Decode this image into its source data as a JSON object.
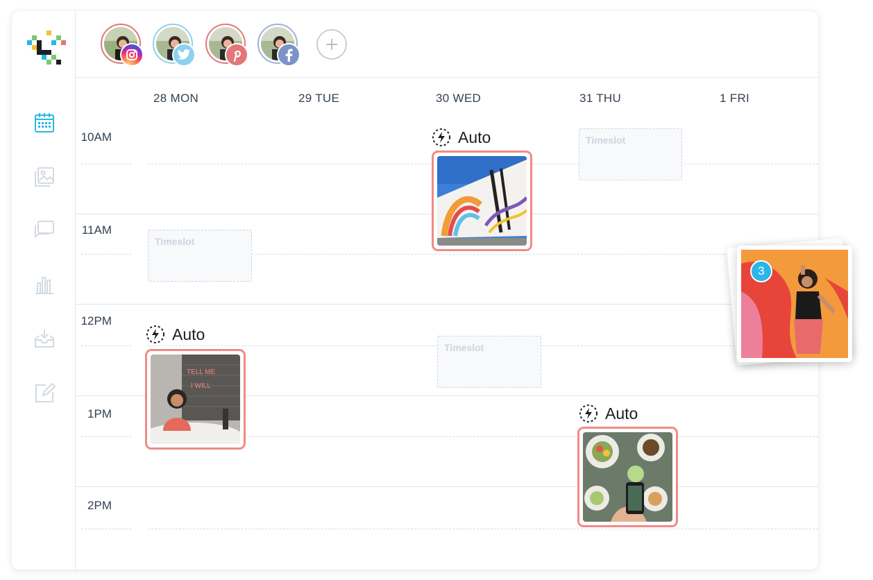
{
  "colors": {
    "accent": "#29b6e8",
    "post_border": "#f08a86",
    "instagram": "#d6249f",
    "twitter": "#55acee",
    "pinterest": "#e2777a",
    "facebook": "#7b93c6"
  },
  "accounts": [
    {
      "network": "instagram",
      "icon": "instagram-icon"
    },
    {
      "network": "twitter",
      "icon": "twitter-icon"
    },
    {
      "network": "pinterest",
      "icon": "pinterest-icon"
    },
    {
      "network": "facebook",
      "icon": "facebook-icon"
    }
  ],
  "sidebar": {
    "items": [
      {
        "name": "calendar",
        "icon": "calendar-icon",
        "active": true
      },
      {
        "name": "media",
        "icon": "image-icon",
        "active": false
      },
      {
        "name": "conversations",
        "icon": "chat-icon",
        "active": false
      },
      {
        "name": "analytics",
        "icon": "bar-chart-icon",
        "active": false
      },
      {
        "name": "inbox",
        "icon": "inbox-icon",
        "active": false
      },
      {
        "name": "edit",
        "icon": "edit-icon",
        "active": false
      }
    ]
  },
  "days": [
    "28 MON",
    "29 TUE",
    "30 WED",
    "31 THU",
    "1 FRI"
  ],
  "times": [
    "10AM",
    "11AM",
    "12PM",
    "1PM",
    "2PM"
  ],
  "timeslot_label": "Timeslot",
  "auto_label": "Auto",
  "drag_badge": "3"
}
